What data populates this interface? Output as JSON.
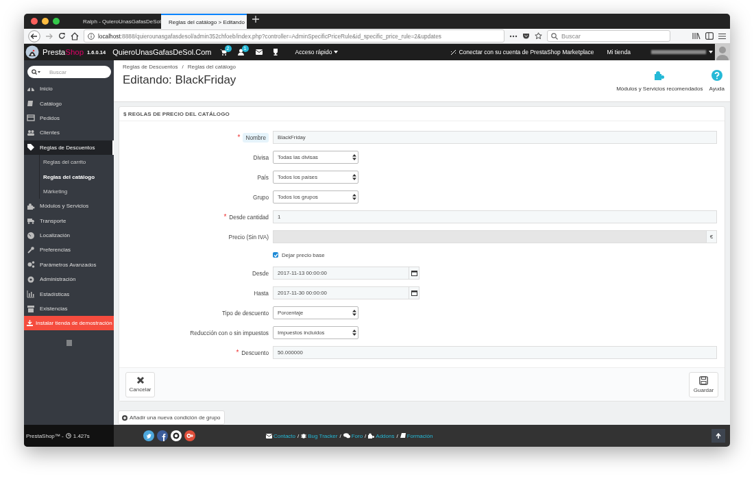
{
  "browser": {
    "tabs": [
      {
        "title": "Ralph - QuieroUnasGafasDeSol",
        "selected": false
      },
      {
        "title": "Reglas del catálogo > Editando",
        "selected": true
      }
    ],
    "url_host": "localhost",
    "url_rest": ":8888/quierounasgafasdesol/admin352chfoeb/index.php?controller=AdminSpecificPriceRule&id_specific_price_rule=2&updates",
    "search_placeholder": "Buscar"
  },
  "header": {
    "brand_first": "Presta",
    "brand_second": "Shop",
    "version": "1.6.0.14",
    "shop_name": "QuieroUnasGafasDeSol.Com",
    "cart_badge": "2",
    "customers_badge": "1",
    "quick_access": "Acceso rápido",
    "connect": "Conectar con su cuenta de PrestaShop Marketplace",
    "my_shop": "Mi tienda"
  },
  "sidebar": {
    "search_placeholder": "Buscar",
    "items": [
      {
        "label": "Inicio",
        "selected": false
      },
      {
        "label": "Catálogo",
        "selected": false
      },
      {
        "label": "Pedidos",
        "selected": false
      },
      {
        "label": "Clientes",
        "selected": false
      },
      {
        "label": "Reglas de Descuentos",
        "selected": true,
        "children": [
          {
            "label": "Reglas del carrito",
            "selected": false
          },
          {
            "label": "Reglas del catálogo",
            "selected": true
          },
          {
            "label": "Márketing",
            "selected": false
          }
        ]
      },
      {
        "label": "Módulos y Servicios",
        "selected": false
      },
      {
        "label": "Transporte",
        "selected": false
      },
      {
        "label": "Localización",
        "selected": false
      },
      {
        "label": "Preferencias",
        "selected": false
      },
      {
        "label": "Parámetros Avanzados",
        "selected": false
      },
      {
        "label": "Administración",
        "selected": false
      },
      {
        "label": "Estadísticas",
        "selected": false
      },
      {
        "label": "Existencias",
        "selected": false
      }
    ],
    "demo_button": "Instalar tienda de demostración"
  },
  "page": {
    "breadcrumb": [
      "Reglas de Descuentos",
      "Reglas del catálogo"
    ],
    "breadcrumb_separator": "/",
    "title": "Editando: BlackFriday",
    "toolbar": [
      "Módulos y Servicios recomendados",
      "Ayuda"
    ]
  },
  "panel": {
    "heading_icon": "$",
    "heading": "REGLAS DE PRECIO DEL CATÁLOGO",
    "required_mark": "*",
    "fields": [
      {
        "kind": "text",
        "label": "Nombre",
        "required": true,
        "hint": true,
        "disabled": false,
        "value": "BlackFriday"
      },
      {
        "kind": "select",
        "label": "Divisa",
        "required": false,
        "hint": false,
        "disabled": false,
        "value": "Todas las divisas"
      },
      {
        "kind": "select",
        "label": "País",
        "required": false,
        "hint": false,
        "disabled": false,
        "value": "Todos los países"
      },
      {
        "kind": "select",
        "label": "Grupo",
        "required": false,
        "hint": false,
        "disabled": false,
        "value": "Todos los grupos"
      },
      {
        "kind": "text",
        "label": "Desde cantidad",
        "required": true,
        "hint": false,
        "disabled": false,
        "value": "1"
      },
      {
        "kind": "price",
        "label": "Precio (Sin IVA)",
        "required": false,
        "hint": false,
        "disabled": true,
        "suffix": "€"
      },
      {
        "kind": "checkbox",
        "label": "Dejar precio base",
        "checked": true
      },
      {
        "kind": "date",
        "label": "Desde",
        "required": false,
        "hint": false,
        "disabled": false,
        "value": "2017-11-13 00:00:00"
      },
      {
        "kind": "date",
        "label": "Hasta",
        "required": false,
        "hint": false,
        "disabled": false,
        "value": "2017-11-30 00:00:00"
      },
      {
        "kind": "select",
        "label": "Tipo de descuento",
        "required": false,
        "hint": false,
        "disabled": false,
        "value": "Porcentaje"
      },
      {
        "kind": "select",
        "label": "Reducción con o sin impuestos",
        "required": false,
        "hint": false,
        "disabled": false,
        "value": "Impuestos incluidos"
      },
      {
        "kind": "text",
        "label": "Descuento",
        "required": true,
        "hint": false,
        "disabled": false,
        "value": "50.000000"
      }
    ],
    "cancel": "Cancelar",
    "save": "Guardar"
  },
  "add_condition": "Añadir una nueva condición de grupo",
  "footer": {
    "brand": "PrestaShop™ -",
    "time": "1.427s",
    "links": [
      "Contacto",
      "Bug Tracker",
      "Foro",
      "Addons",
      "Formación"
    ],
    "separator": "/"
  }
}
